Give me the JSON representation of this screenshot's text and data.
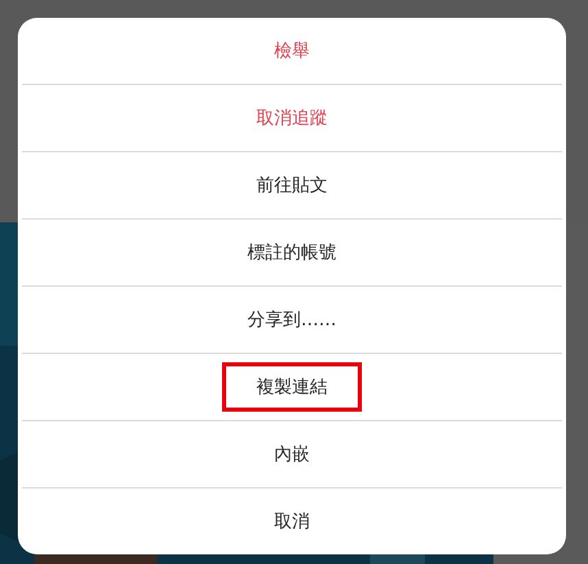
{
  "menu": {
    "items": [
      {
        "label": "檢舉",
        "kind": "danger",
        "highlighted": false
      },
      {
        "label": "取消追蹤",
        "kind": "danger",
        "highlighted": false
      },
      {
        "label": "前往貼文",
        "kind": "normal",
        "highlighted": false
      },
      {
        "label": "標註的帳號",
        "kind": "normal",
        "highlighted": false
      },
      {
        "label": "分享到……",
        "kind": "normal",
        "highlighted": false
      },
      {
        "label": "複製連結",
        "kind": "normal",
        "highlighted": true
      },
      {
        "label": "內嵌",
        "kind": "normal",
        "highlighted": false
      },
      {
        "label": "取消",
        "kind": "normal",
        "highlighted": false
      }
    ]
  }
}
